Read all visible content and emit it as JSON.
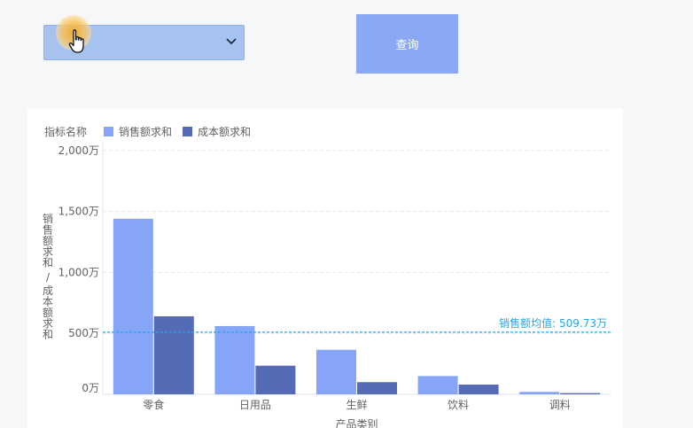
{
  "controls": {
    "dropdown_value": "",
    "query_label": "查询"
  },
  "colors": {
    "series1": "#86a5f6",
    "series2": "#566bb6",
    "avg_line": "#1fa7ec",
    "dropdown": "#a6c3f0",
    "button": "#8aa8f3"
  },
  "icons": {
    "dropdown": "chevron-down-icon",
    "cursor": "hand-pointer-icon"
  },
  "legend": {
    "title": "指标名称"
  },
  "chart_data": {
    "type": "bar",
    "categories": [
      "零食",
      "日用品",
      "生鲜",
      "饮料",
      "调料"
    ],
    "series": [
      {
        "name": "销售额求和",
        "values": [
          1440,
          560,
          365,
          150,
          20
        ]
      },
      {
        "name": "成本额求和",
        "values": [
          640,
          235,
          100,
          80,
          10
        ]
      }
    ],
    "ylabel": "销售额求和 / 成本额求和",
    "xlabel": "产品类别",
    "yticks": [
      {
        "value": 0,
        "label": "0万"
      },
      {
        "value": 500,
        "label": "500万"
      },
      {
        "value": 1000,
        "label": "1,000万"
      },
      {
        "value": 1500,
        "label": "1,500万"
      },
      {
        "value": 2000,
        "label": "2,000万"
      }
    ],
    "ylim": [
      -100,
      2000
    ],
    "average_line": {
      "value": 509.73,
      "label": "销售额均值: 509.73万"
    },
    "grid": true,
    "legend_position": "top-left"
  }
}
